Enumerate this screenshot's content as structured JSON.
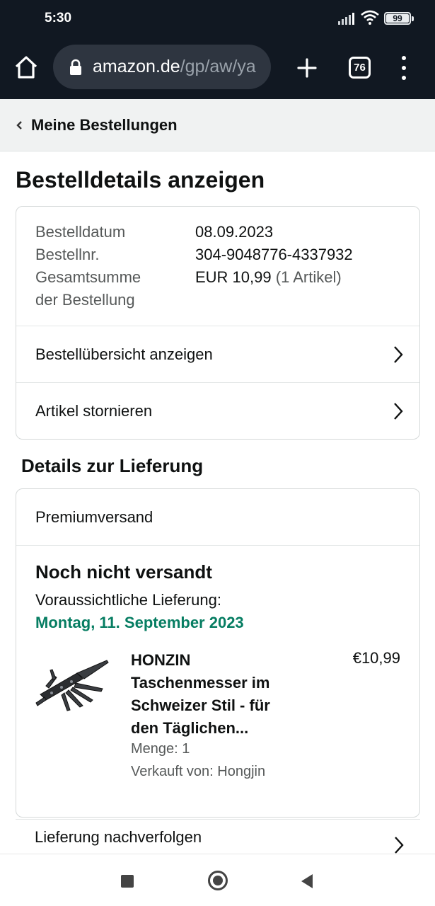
{
  "status_bar": {
    "time": "5:30",
    "battery": "99"
  },
  "browser": {
    "url_host": "amazon.de",
    "url_path": "/gp/aw/ya",
    "tab_count": "76"
  },
  "breadcrumb": {
    "label": "Meine Bestellungen"
  },
  "page_title": "Bestelldetails anzeigen",
  "order_summary": {
    "date_label": "Bestelldatum",
    "date_value": "08.09.2023",
    "number_label": "Bestellnr.",
    "number_value": "304-9048776-4337932",
    "total_label_line1": "Gesamtsumme",
    "total_label_line2": "der Bestellung",
    "total_value": "EUR 10,99",
    "total_items": "(1 Artikel)"
  },
  "actions": {
    "view_summary": "Bestellübersicht anzeigen",
    "cancel_items": "Artikel stornieren"
  },
  "delivery": {
    "section_title": "Details zur Lieferung",
    "shipping_method": "Premiumversand",
    "status": "Noch nicht versandt",
    "eta_label": "Voraussichtliche Lieferung:",
    "eta_date": "Montag, 11. September 2023",
    "product": {
      "title": "HONZIN Taschenmesser im Schweizer Stil - für den Täglichen...",
      "price": "€10,99",
      "quantity": "Menge: 1",
      "seller": "Verkauft von: Hongjin"
    },
    "track_label": "Lieferung nachverfolgen"
  },
  "colors": {
    "eta_green": "#067d62",
    "chrome_bg": "#111822",
    "crumb_bg": "#f0f2f2"
  },
  "icons": [
    "home-icon",
    "lock-icon",
    "plus-icon",
    "tabs-icon",
    "more-vert-icon",
    "chevron-left-icon",
    "chevron-right-icon",
    "nav-recents-icon",
    "nav-home-icon",
    "nav-back-icon"
  ]
}
